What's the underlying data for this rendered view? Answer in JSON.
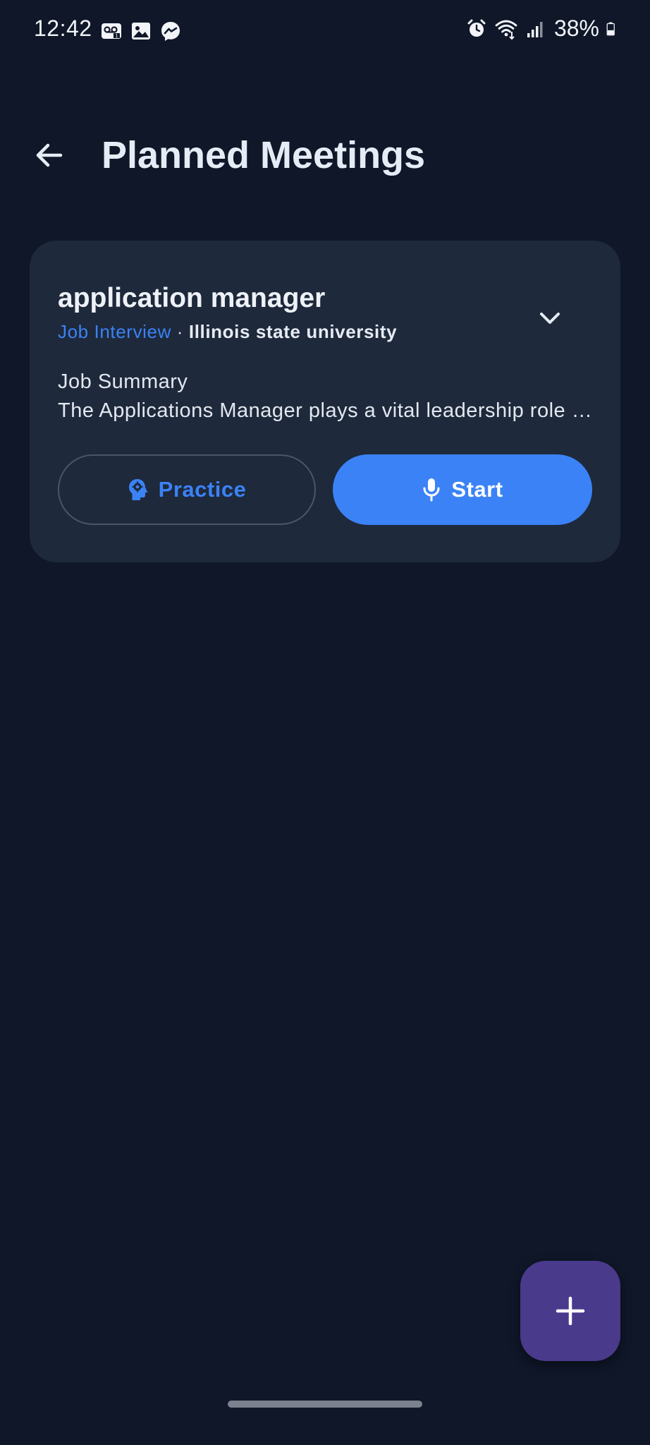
{
  "status_bar": {
    "time": "12:42",
    "battery": "38%",
    "notification_icons": [
      "voicemail-icon",
      "image-icon",
      "messenger-icon"
    ],
    "system_icons": [
      "alarm-icon",
      "wifi-icon",
      "signal-icon",
      "battery-icon"
    ]
  },
  "header": {
    "title": "Planned Meetings",
    "back_icon": "arrow-left-icon"
  },
  "meetings": [
    {
      "title": "application manager",
      "type": "Job Interview",
      "separator": " · ",
      "company": "Illinois state university",
      "summary_heading": "Job Summary",
      "summary_text": "The Applications Manager plays a vital leadership role in overseeing and managing applications",
      "practice_label": "Practice",
      "start_label": "Start",
      "expand_icon": "chevron-down-icon"
    }
  ],
  "fab": {
    "icon": "plus-icon"
  },
  "colors": {
    "background": "#0f1729",
    "card": "#1e293b",
    "accent": "#3b82f6",
    "fab": "#4a3a8c"
  }
}
